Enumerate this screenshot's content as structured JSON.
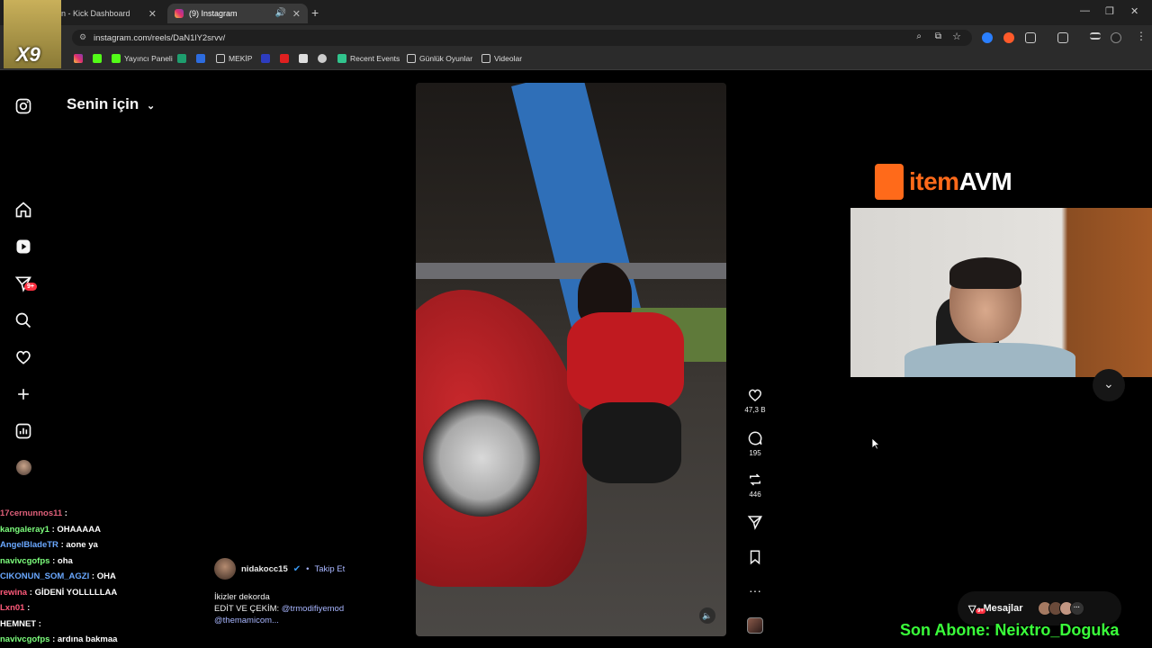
{
  "browser": {
    "tabs": [
      {
        "title": "n - Kick Dashboard",
        "active": false
      },
      {
        "title": "(9) Instagram",
        "active": true
      }
    ],
    "url": "instagram.com/reels/DaN1lY2srvv/",
    "bookmarks": [
      "Yayıncı Paneli",
      "MEKİP",
      "Recent Events",
      "Günlük Oyunlar",
      "Videolar"
    ]
  },
  "overlay": {
    "streamer_tag": "X9",
    "sub_banner": "Son Abone: Neixtro_Doguka",
    "sponsor": {
      "brand_item": "item",
      "brand_avm": "AVM"
    },
    "chat": [
      {
        "user": "17cernunnos11",
        "color": "#e0607a",
        "msg": ""
      },
      {
        "user": "kangaleray1",
        "color": "#7dff7d",
        "msg": "OHAAAAA"
      },
      {
        "user": "AngelBladeTR",
        "color": "#6aa8ff",
        "msg": "aone ya"
      },
      {
        "user": "navivcgofps",
        "color": "#7dff7d",
        "msg": "oha"
      },
      {
        "user": "CIKONUN_SOM_AGZI",
        "color": "#6aa8ff",
        "msg": "OHA"
      },
      {
        "user": "rewina",
        "color": "#ff5a7a",
        "msg": "GİDENİ YOLLLLLAA"
      },
      {
        "user": "Lxn01",
        "color": "#ff5a7a",
        "msg": ""
      },
      {
        "user": "HEMNET",
        "color": "#ffffff",
        "msg": ""
      },
      {
        "user": "navivcgofps",
        "color": "#7dff7d",
        "msg": "ardına bakmaa"
      }
    ]
  },
  "instagram": {
    "feed_title": "Senin için",
    "notification_badge": "9+",
    "post": {
      "username": "nidakocc15",
      "follow_label": "Takip Et",
      "caption_line1": "İkizler dekorda",
      "caption_line2_prefix": "EDİT VE ÇEKİM:",
      "mention1": "@trmodifiyemod",
      "mention2": "@themamicom...",
      "likes": "47,3 B",
      "comments": "195",
      "reposts": "446"
    },
    "messages_label": "Mesajlar",
    "messages_badge": "9+"
  }
}
